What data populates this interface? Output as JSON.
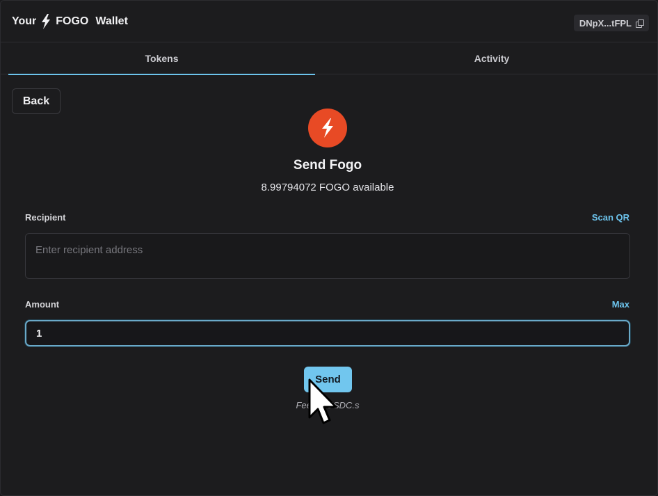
{
  "header": {
    "brand_prefix": "Your",
    "brand_name": "FOGO",
    "brand_suffix": "Wallet",
    "address_short": "DNpX...tFPL",
    "icons": {
      "brand": "bolt-icon",
      "copy": "copy-icon"
    }
  },
  "tabs": [
    {
      "label": "Tokens",
      "active": true
    },
    {
      "label": "Activity",
      "active": false
    }
  ],
  "back_label": "Back",
  "send_form": {
    "token_icon": "fogo-logo-icon",
    "title": "Send Fogo",
    "available": "8.99794072 FOGO available",
    "recipient": {
      "label": "Recipient",
      "placeholder": "Enter recipient address",
      "value": "",
      "scan_label": "Scan QR"
    },
    "amount": {
      "label": "Amount",
      "value": "1",
      "max_label": "Max"
    },
    "send_label": "Send",
    "fee_text": "Fee: ... USDC.s"
  },
  "colors": {
    "accent": "#6cc3ec",
    "brand": "#e84a25",
    "background": "#1c1c1e"
  }
}
